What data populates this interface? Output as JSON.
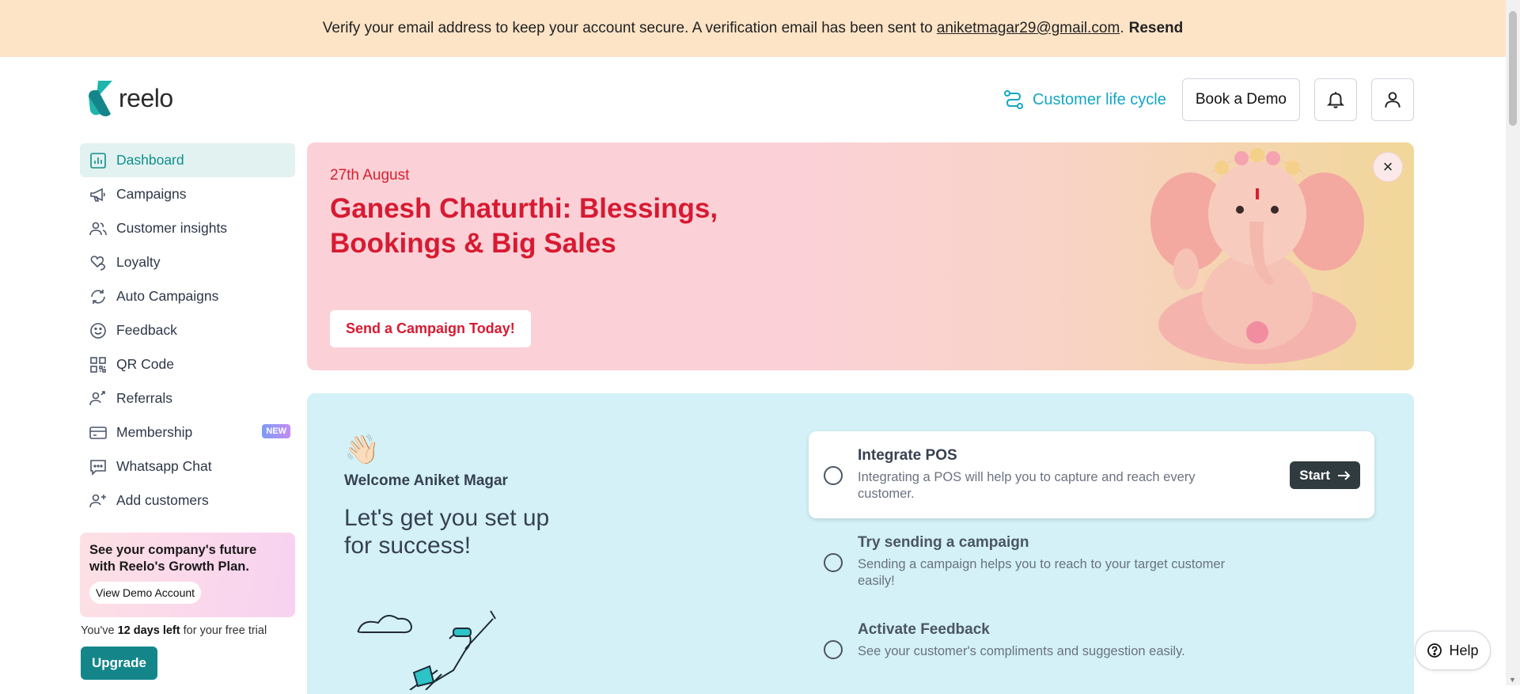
{
  "verify_banner": {
    "message": "Verify your email address to keep your account secure. A verification email has been sent to",
    "email": "aniketmagar29@gmail.com",
    "period": ".",
    "resend": "Resend"
  },
  "header": {
    "logo_text": "reelo",
    "customer_life_cycle": "Customer life cycle",
    "book_demo": "Book a Demo"
  },
  "sidebar": {
    "items": [
      {
        "label": "Dashboard",
        "icon": "chart-icon"
      },
      {
        "label": "Campaigns",
        "icon": "megaphone-icon"
      },
      {
        "label": "Customer insights",
        "icon": "users-icon"
      },
      {
        "label": "Loyalty",
        "icon": "hearts-icon"
      },
      {
        "label": "Auto Campaigns",
        "icon": "refresh-icon"
      },
      {
        "label": "Feedback",
        "icon": "smile-icon"
      },
      {
        "label": "QR Code",
        "icon": "qr-icon"
      },
      {
        "label": "Referrals",
        "icon": "user-arrow-icon"
      },
      {
        "label": "Membership",
        "icon": "card-icon",
        "badge": "NEW"
      },
      {
        "label": "Whatsapp Chat",
        "icon": "chat-icon"
      },
      {
        "label": "Add customers",
        "icon": "user-plus-icon"
      }
    ],
    "promo": {
      "text": "See your company's future with Reelo's Growth Plan.",
      "button": "View Demo Account"
    },
    "trial": {
      "prefix": "You've",
      "days": "12 days left",
      "suffix": "for your free trial"
    },
    "upgrade": "Upgrade"
  },
  "festival": {
    "date": "27th August",
    "title": "Ganesh Chaturthi: Blessings, Bookings & Big Sales",
    "cta": "Send a Campaign Today!",
    "close": "×"
  },
  "setup": {
    "wave": "👋🏻",
    "welcome": "Welcome Aniket Magar",
    "heading": "Let's get you set up for success!",
    "tasks": [
      {
        "title": "Integrate POS",
        "desc": "Integrating a POS will help you to capture and reach every customer.",
        "button": "Start"
      },
      {
        "title": "Try sending a campaign",
        "desc": "Sending a campaign helps you to reach to your target customer easily!"
      },
      {
        "title": "Activate Feedback",
        "desc": "See your customer's compliments and suggestion easily."
      }
    ]
  },
  "help": "Help",
  "colors": {
    "accent": "#14868a",
    "banner": "#fde4c7",
    "festival_red": "#d71a32",
    "link_blue": "#14a6c4"
  }
}
